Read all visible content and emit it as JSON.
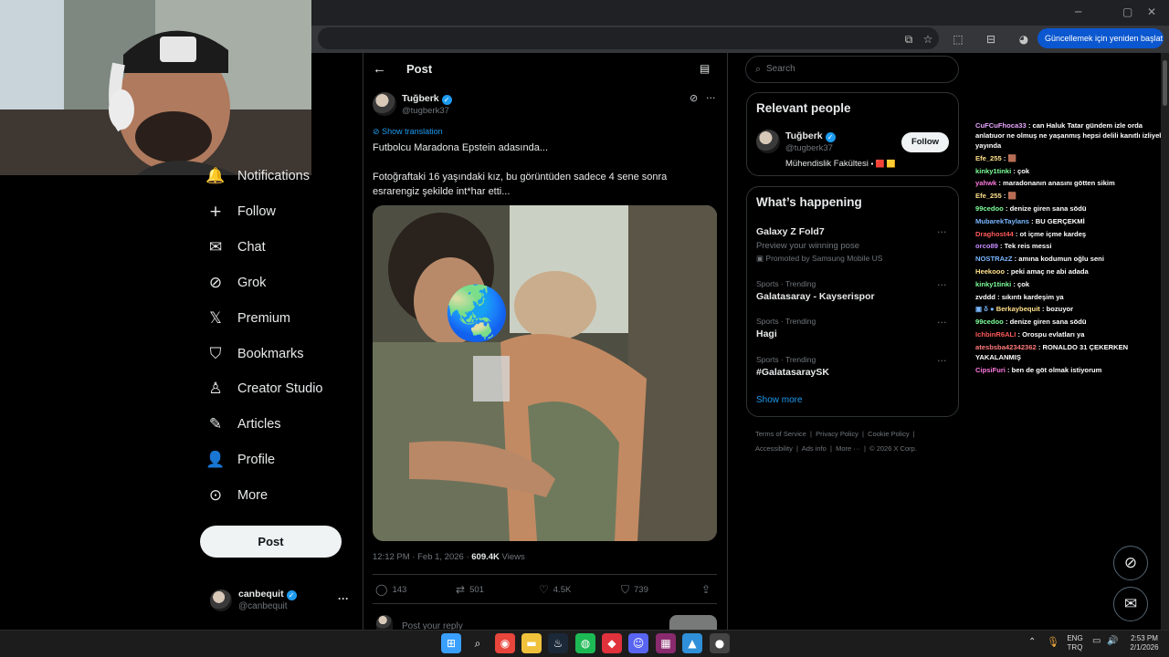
{
  "browser": {
    "update_button": "Güncellemek için yeniden başlat",
    "minimize": "─",
    "maximize": "▢",
    "close": "✕"
  },
  "nav": {
    "items": [
      {
        "label": "Notifications",
        "icon": "bell-icon",
        "glyph": "🔔"
      },
      {
        "label": "Follow",
        "icon": "add-person-icon",
        "glyph": "+"
      },
      {
        "label": "Chat",
        "icon": "mail-icon",
        "glyph": "✉"
      },
      {
        "label": "Grok",
        "icon": "grok-icon",
        "glyph": "⊘"
      },
      {
        "label": "Premium",
        "icon": "x-logo-icon",
        "glyph": "𝕏"
      },
      {
        "label": "Bookmarks",
        "icon": "bookmark-icon",
        "glyph": "⛉"
      },
      {
        "label": "Creator Studio",
        "icon": "creator-studio-icon",
        "glyph": "♙"
      },
      {
        "label": "Articles",
        "icon": "articles-icon",
        "glyph": "✎"
      },
      {
        "label": "Profile",
        "icon": "person-icon",
        "glyph": "👤"
      },
      {
        "label": "More",
        "icon": "more-circle-icon",
        "glyph": "⊙"
      }
    ],
    "post_button": "Post",
    "account": {
      "name": "canbequit",
      "handle": "@canbequit",
      "more": "···"
    }
  },
  "post_header": {
    "back": "←",
    "title": "Post",
    "reader_icon": "▤"
  },
  "tweet": {
    "author_name": "Tuğberk",
    "author_handle": "@tugberk37",
    "show_translation": "Show translation",
    "text_line1": "Futbolcu Maradona Epstein adasında...",
    "text_line2": "Fotoğraftaki 16 yaşındaki kız, bu görüntüden sadece 4 sene sonra esrarengiz şekilde int*har etti...",
    "time": "12:12 PM · Feb 1, 2026 · ",
    "views_count": "609.4K",
    "views_label": " Views",
    "globe": "🌏",
    "actions": {
      "replies": "143",
      "reposts": "501",
      "likes": "4.5K",
      "bookmarks": "739"
    }
  },
  "reply_placeholder": "Post your reply",
  "right": {
    "search_placeholder": "Search",
    "relevant": {
      "title": "Relevant people",
      "name": "Tuğberk",
      "handle": "@tugberk37",
      "bio": "Mühendislik Fakültesi",
      "follow": "Follow"
    },
    "happening": {
      "title": "What’s happening",
      "promo": {
        "name": "Galaxy Z Fold7",
        "sub": "Preview your winning pose",
        "promoted": "Promoted by Samsung Mobile US"
      },
      "trends": [
        {
          "meta": "Sports · Trending",
          "name": "Galatasaray - Kayserispor"
        },
        {
          "meta": "Sports · Trending",
          "name": "Hagi"
        },
        {
          "meta": "Sports · Trending",
          "name": "#GalatasaraySK"
        }
      ],
      "show_more": "Show more"
    },
    "footer": {
      "line1": [
        "Terms of Service",
        "Privacy Policy",
        "Cookie Policy"
      ],
      "line2": [
        "Accessibility",
        "Ads info",
        "More ···",
        "© 2026 X Corp."
      ]
    }
  },
  "chat": [
    {
      "user": "CuFCuFhoca33",
      "color": "#e9a6ff",
      "msg": ": can Haluk Tatar gündem izle orda anlatıuor ne olmuş ne yaşanmış hepsi delili kanıtlı izliyek yayında"
    },
    {
      "user": "Efe_255",
      "color": "#ffe08a",
      "msg": ": 🟫"
    },
    {
      "user": "kinky1tinki",
      "color": "#7dff9a",
      "msg": ": çok"
    },
    {
      "user": "yahwk",
      "color": "#ff79e0",
      "msg": ": maradonanın anasını götten sikim"
    },
    {
      "user": "Efe_255",
      "color": "#ffe08a",
      "msg": ": 🟫"
    },
    {
      "user": "99cedoo",
      "color": "#7dff9a",
      "msg": ": denize giren sana södü"
    },
    {
      "user": "MubarekTaylans",
      "color": "#7ab8ff",
      "msg": ": BU GERÇEKMİ"
    },
    {
      "user": "Draghost44",
      "color": "#ff5a5a",
      "msg": ": ot içme içme kardeş"
    },
    {
      "user": "orco89",
      "color": "#c58cff",
      "msg": ": Tek reis messi"
    },
    {
      "user": "NOSTRAzZ",
      "color": "#7ab8ff",
      "msg": ": amına kodumun oğlu seni"
    },
    {
      "user": "Heekooo",
      "color": "#ffe08a",
      "msg": ": peki amaç ne abi adada"
    },
    {
      "user": "kinky1tinki",
      "color": "#7dff9a",
      "msg": ": çok"
    },
    {
      "user": "zvddd",
      "color": "#ffffff",
      "msg": ": sıkıntı kardeşim ya"
    },
    {
      "user": "Berkaybequit",
      "color": "#ffe08a",
      "msg": ": bozuyor",
      "prefix": "▣ δ ●"
    },
    {
      "user": "99cedoo",
      "color": "#7dff9a",
      "msg": ": denize giren sana södü"
    },
    {
      "user": "IchbinR6ALI",
      "color": "#ff5a5a",
      "msg": ": Orospu evlatları ya"
    },
    {
      "user": "atesbsba42342362",
      "color": "#ff7a7a",
      "msg": ": RONALDO 31 ÇEKERKEN YAKALANMIŞ"
    },
    {
      "user": "CipsiFuri",
      "color": "#ff79e0",
      "msg": ": ben de göt olmak istiyorum"
    }
  ],
  "taskbar": {
    "lang_top": "ENG",
    "lang_bottom": "TRQ",
    "time": "2:53 PM",
    "date": "2/1/2026",
    "apps": [
      {
        "icon": "windows-start-icon",
        "glyph": "⊞",
        "color": "#3aa0ff"
      },
      {
        "icon": "search-icon",
        "glyph": "⌕",
        "color": "transparent"
      },
      {
        "icon": "chrome-icon",
        "glyph": "◉",
        "color": "#e8453c"
      },
      {
        "icon": "file-explorer-icon",
        "glyph": "▬",
        "color": "#f0c23c"
      },
      {
        "icon": "steam-icon",
        "glyph": "♨",
        "color": "#1b2838"
      },
      {
        "icon": "spotify-icon",
        "glyph": "◍",
        "color": "#1db954"
      },
      {
        "icon": "app-red-icon",
        "glyph": "◆",
        "color": "#e0323c"
      },
      {
        "icon": "discord-icon",
        "glyph": "☺",
        "color": "#5865f2"
      },
      {
        "icon": "winrar-icon",
        "glyph": "▦",
        "color": "#8a2a6e"
      },
      {
        "icon": "photos-icon",
        "glyph": "▲",
        "color": "#2f8fd8"
      },
      {
        "icon": "app-recorder-icon",
        "glyph": "●",
        "color": "#444444"
      }
    ]
  }
}
